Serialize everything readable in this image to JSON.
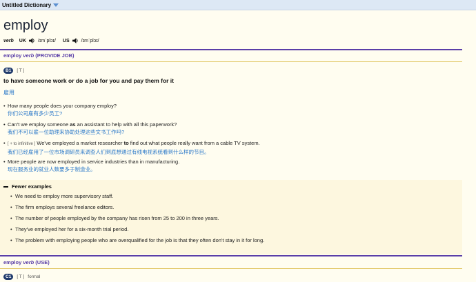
{
  "app": {
    "title": "Untitled Dictionary"
  },
  "entry": {
    "headword": "employ",
    "pos": "verb",
    "uk_label": "UK",
    "uk_ipa": "/ɪmˈplɔɪ/",
    "us_label": "US",
    "us_ipa": "/ɪmˈplɔɪ/"
  },
  "sense1": {
    "word": "employ",
    "pos": "verb",
    "guide": "(PROVIDE JOB)",
    "level": "B1",
    "grammar": "[ T ]",
    "definition": "to have someone work or do a job for you and pay them for it",
    "translation": "雇用",
    "examples": [
      {
        "bullet": "•",
        "en": "How many people does your company employ?",
        "zh": "你们公司雇有多少员工?"
      },
      {
        "bullet": "•",
        "en_pre": "Can't we employ someone ",
        "en_bold": "as",
        "en_post": " an assistant to help with all this paperwork?",
        "zh": "我们不可以雇一位助理来协助处理这些文书工作吗?"
      },
      {
        "bullet": "•",
        "gram": "[ + to infinitive ]",
        "en_pre": " We've employed a market researcher ",
        "en_bold": "to",
        "en_post": " find out what people really want from a cable TV system.",
        "zh": "我们已经雇用了一位市场调研员来调查人们到底想通过有线电视系统看到什么样的节目。"
      },
      {
        "bullet": "•",
        "en": "More people are now employed in service industries than in manufacturing.",
        "zh": "现在服务业的就业人数要多于制造业。"
      }
    ]
  },
  "fewer": {
    "label": "Fewer examples",
    "items": [
      "We need to employ more supervisory staff.",
      "The firm employs several freelance editors.",
      "The number of people employed by the company has risen from 25 to 200 in three years.",
      "They've employed her for a six-month trial period.",
      "The problem with employing people who are overqualified for the job is that they often don't stay in it for long."
    ]
  },
  "sense2": {
    "word": "employ",
    "pos": "verb",
    "guide": "(USE)",
    "level": "C1",
    "grammar": "[ T ]",
    "register": "formal"
  },
  "colors": {
    "accent": "#5a3ea8",
    "link": "#2a78c9",
    "badge": "#1f3a6b",
    "gold": "#e3c96a"
  }
}
